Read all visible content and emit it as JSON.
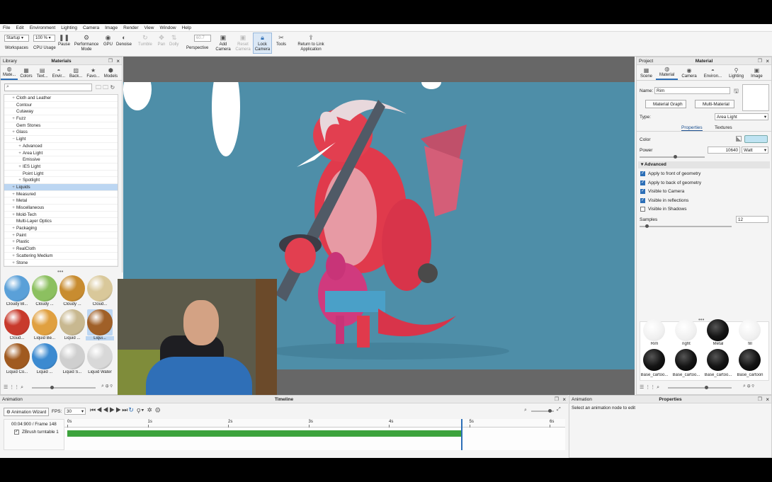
{
  "menu": [
    "File",
    "Edit",
    "Environment",
    "Lighting",
    "Camera",
    "Image",
    "Render",
    "View",
    "Window",
    "Help"
  ],
  "toolbar": {
    "workspace_value": "Startup",
    "workspace_label": "Workspaces",
    "cpu_value": "100 %",
    "cpu_label": "CPU Usage",
    "pause": "Pause",
    "performance_mode": "Performance Mode",
    "gpu": "GPU",
    "denoise": "Denoise",
    "tumble": "Tumble",
    "pan": "Pan",
    "dolly": "Dolly",
    "fov_value": "60.7",
    "perspective": "Perspective",
    "add_camera": "Add Camera",
    "reset_camera": "Reset Camera",
    "lock_camera": "Lock Camera",
    "tools": "Tools",
    "return_to_link": "Return to Link Application"
  },
  "library": {
    "title": "Library",
    "panel_title": "Materials",
    "tabs": [
      "Mate...",
      "Colors",
      "Text...",
      "Envir...",
      "Back...",
      "Favo...",
      "Models"
    ],
    "tree": [
      {
        "label": "Cloth and Leather",
        "indent": 1,
        "pm": "+"
      },
      {
        "label": "Contour",
        "indent": 1,
        "pm": ""
      },
      {
        "label": "Cutaway",
        "indent": 1,
        "pm": ""
      },
      {
        "label": "Fuzz",
        "indent": 1,
        "pm": "+"
      },
      {
        "label": "Gem Stones",
        "indent": 1,
        "pm": ""
      },
      {
        "label": "Glass",
        "indent": 1,
        "pm": "+"
      },
      {
        "label": "Light",
        "indent": 1,
        "pm": "−"
      },
      {
        "label": "Advanced",
        "indent": 2,
        "pm": "+"
      },
      {
        "label": "Area Light",
        "indent": 2,
        "pm": "+"
      },
      {
        "label": "Emissive",
        "indent": 2,
        "pm": ""
      },
      {
        "label": "IES Light",
        "indent": 2,
        "pm": "+"
      },
      {
        "label": "Point Light",
        "indent": 2,
        "pm": ""
      },
      {
        "label": "Spotlight",
        "indent": 2,
        "pm": "+"
      },
      {
        "label": "Liquids",
        "indent": 1,
        "pm": "+",
        "selected": true
      },
      {
        "label": "Measured",
        "indent": 1,
        "pm": "+"
      },
      {
        "label": "Metal",
        "indent": 1,
        "pm": "+"
      },
      {
        "label": "Miscellaneous",
        "indent": 1,
        "pm": "+"
      },
      {
        "label": "Mold-Tech",
        "indent": 1,
        "pm": "+"
      },
      {
        "label": "Multi-Layer Optics",
        "indent": 1,
        "pm": ""
      },
      {
        "label": "Packaging",
        "indent": 1,
        "pm": "+"
      },
      {
        "label": "Paint",
        "indent": 1,
        "pm": "+"
      },
      {
        "label": "Plastic",
        "indent": 1,
        "pm": "+"
      },
      {
        "label": "RealCloth",
        "indent": 1,
        "pm": "+"
      },
      {
        "label": "Scattering Medium",
        "indent": 1,
        "pm": "+"
      },
      {
        "label": "Stone",
        "indent": 1,
        "pm": "+"
      }
    ],
    "swatches": [
      {
        "label": "Cloudy Bl...",
        "color": "#5aa0d8"
      },
      {
        "label": "Cloudy ...",
        "color": "#8cc060"
      },
      {
        "label": "Cloudy ...",
        "color": "#c88c30"
      },
      {
        "label": "Cloud...",
        "color": "#d9c89a"
      },
      {
        "label": "Cloud...",
        "color": "#c83a2c"
      },
      {
        "label": "Liquid Be...",
        "color": "#e0a040"
      },
      {
        "label": "Liquid ...",
        "color": "#c8b890"
      },
      {
        "label": "Liqui...",
        "color": "#a06028",
        "selected": true
      },
      {
        "label": "Liquid Co...",
        "color": "#a05a20"
      },
      {
        "label": "Liquid ...",
        "color": "#3c8ad0"
      },
      {
        "label": "Liquid S...",
        "color": "#cfcfcf"
      },
      {
        "label": "Liquid Water",
        "color": "#d8d8d8"
      }
    ]
  },
  "project": {
    "title": "Project",
    "panel_title": "Material",
    "tabs": [
      "Scene",
      "Material",
      "Camera",
      "Environ...",
      "Lighting",
      "Image"
    ],
    "name_label": "Name:",
    "name_value": "Rim",
    "material_graph": "Material Graph",
    "multi_material": "Multi-Material",
    "type_label": "Type:",
    "type_value": "Area Light",
    "subtabs": [
      "Properties",
      "Textures"
    ],
    "color_label": "Color",
    "color_value": "#bfe3f2",
    "power_label": "Power",
    "power_value": "10640",
    "power_unit": "Watt",
    "advanced_header": "Advanced",
    "checkboxes": [
      {
        "label": "Apply to front of geometry",
        "checked": true
      },
      {
        "label": "Apply to back of geometry",
        "checked": true
      },
      {
        "label": "Visible to Camera",
        "checked": true
      },
      {
        "label": "Visible in reflections",
        "checked": true
      },
      {
        "label": "Visible in Shadows",
        "checked": false
      }
    ],
    "samples_label": "Samples",
    "samples_value": "12",
    "thumbs_row1": [
      "Rim",
      "right",
      "Metal",
      "fill"
    ],
    "thumbs_row2": [
      "Base_cartoo...",
      "Base_cartoo...",
      "Base_cartoo...",
      "Base_cartoon"
    ]
  },
  "animation": {
    "title": "Animation",
    "center_title": "Timeline",
    "wizard": "Animation Wizard",
    "fps_label": "FPS:",
    "fps_value": "30",
    "time": "00:04:900 / Frame 148",
    "track": "ZBrush turntable 1",
    "ticks": [
      "0s",
      "1s",
      "2s",
      "3s",
      "4s",
      "5s",
      "6s"
    ],
    "playhead_seconds": 4.9
  },
  "properties": {
    "left_title": "Animation",
    "center_title": "Properties",
    "hint": "Select an animation node to edit"
  }
}
